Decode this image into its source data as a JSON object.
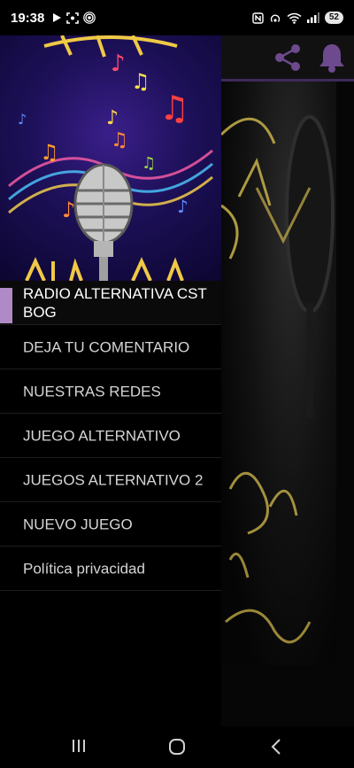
{
  "status_bar": {
    "time": "19:38",
    "battery": "52",
    "left_icons": [
      "play-icon",
      "screenshot-icon",
      "hotspot-icon"
    ],
    "right_icons": [
      "nfc-icon",
      "hotspot-icon",
      "wifi-icon",
      "signal-icon",
      "battery-icon"
    ]
  },
  "toolbar": {
    "icons": [
      "share-icon",
      "bell-icon"
    ],
    "accent": "#7b4fa8"
  },
  "drawer": {
    "header_art_text": "RADIO ALTERNATIVA",
    "items": [
      {
        "label": "RADIO ALTERNATIVA CST BOG",
        "active": true
      },
      {
        "label": "DEJA TU COMENTARIO",
        "active": false
      },
      {
        "label": "NUESTRAS REDES",
        "active": false
      },
      {
        "label": "JUEGO ALTERNATIVO",
        "active": false
      },
      {
        "label": "JUEGOS ALTERNATIVO 2",
        "active": false
      },
      {
        "label": "NUEVO JUEGO",
        "active": false
      },
      {
        "label": "Política privacidad",
        "active": false
      }
    ],
    "active_color": "#b08ac6"
  },
  "background": {
    "neon_text": "RADIO ALTERNATIVA"
  },
  "nav_bar": {
    "icons": [
      "recents-icon",
      "home-icon",
      "back-icon"
    ]
  }
}
